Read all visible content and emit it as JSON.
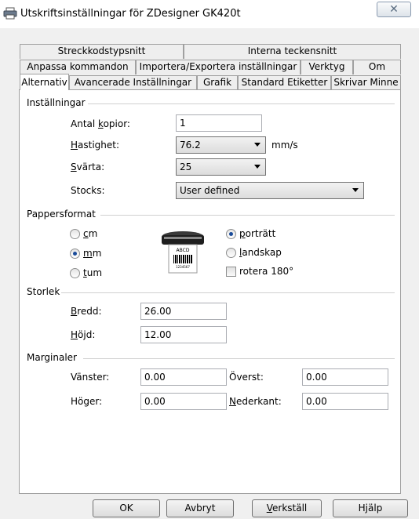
{
  "window": {
    "title": "Utskriftsinställningar för ZDesigner GK420t",
    "close_glyph": "✕"
  },
  "tabs": {
    "row1": [
      "Streckkodstypsnitt",
      "Interna teckensnitt"
    ],
    "row2": [
      "Anpassa kommandon",
      "Importera/Exportera inställningar",
      "Verktyg",
      "Om"
    ],
    "row3": [
      "Alternativ",
      "Avancerade Inställningar",
      "Grafik",
      "Standard Etiketter",
      "Skrivar Minne"
    ],
    "active": "Alternativ"
  },
  "settings": {
    "section_label": "Inställningar",
    "copies_label": "Antal kopior:",
    "copies_value": "1",
    "speed_label": "Hastighet:",
    "speed_value": "76.2",
    "speed_unit": "mm/s",
    "darkness_label": "Svärta:",
    "darkness_value": "25",
    "stocks_label": "Stocks:",
    "stocks_value": "User defined"
  },
  "paper_format": {
    "section_label": "Pappersformat",
    "units": [
      "cm",
      "mm",
      "tum"
    ],
    "selected_unit": "mm",
    "orientation": [
      "porträtt",
      "landskap"
    ],
    "selected_orientation": "porträtt",
    "rotate_label": "rotera 180°",
    "rotate_checked": false,
    "preview_label": "ABCD",
    "preview_barcode_digits": "1234567"
  },
  "size": {
    "section_label": "Storlek",
    "width_label": "Bredd:",
    "width_value": "26.00",
    "height_label": "Höjd:",
    "height_value": "12.00"
  },
  "margins": {
    "section_label": "Marginaler",
    "left_label": "Vänster:",
    "left_value": "0.00",
    "top_label": "Överst:",
    "top_value": "0.00",
    "right_label": "Höger:",
    "right_value": "0.00",
    "bottom_label": "Nederkant:",
    "bottom_value": "0.00"
  },
  "buttons": {
    "ok": "OK",
    "cancel": "Avbryt",
    "apply": "Verkställ",
    "help": "Hjälp"
  }
}
